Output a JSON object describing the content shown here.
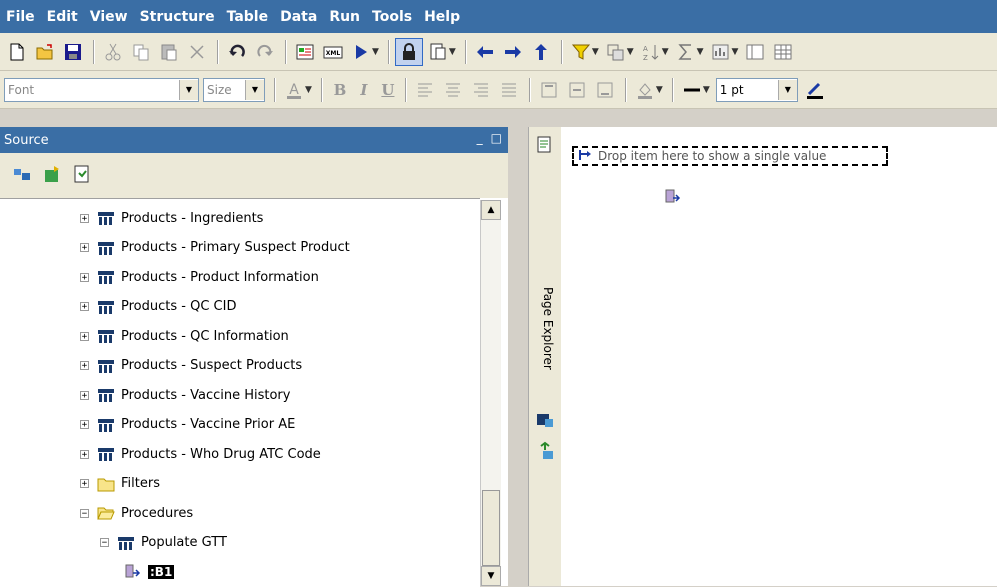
{
  "menu": [
    "File",
    "Edit",
    "View",
    "Structure",
    "Table",
    "Data",
    "Run",
    "Tools",
    "Help"
  ],
  "format_toolbar": {
    "font_placeholder": "Font",
    "size_placeholder": "Size",
    "bold": "B",
    "italic": "I",
    "underline": "U",
    "line_width": "1 pt"
  },
  "source": {
    "title": "Source",
    "minimize": "_",
    "maximize": "□",
    "tree": [
      {
        "label": "Products - Ingredients",
        "type": "query",
        "expander": "+",
        "level": 2
      },
      {
        "label": "Products - Primary Suspect Product",
        "type": "query",
        "expander": "+",
        "level": 2
      },
      {
        "label": "Products - Product Information",
        "type": "query",
        "expander": "+",
        "level": 2
      },
      {
        "label": "Products - QC CID",
        "type": "query",
        "expander": "+",
        "level": 2
      },
      {
        "label": "Products - QC Information",
        "type": "query",
        "expander": "+",
        "level": 2
      },
      {
        "label": "Products - Suspect Products",
        "type": "query",
        "expander": "+",
        "level": 2
      },
      {
        "label": "Products - Vaccine History",
        "type": "query",
        "expander": "+",
        "level": 2
      },
      {
        "label": "Products - Vaccine Prior AE",
        "type": "query",
        "expander": "+",
        "level": 2
      },
      {
        "label": "Products - Who Drug ATC Code",
        "type": "query",
        "expander": "+",
        "level": 2
      },
      {
        "label": "Filters",
        "type": "folder",
        "expander": "+",
        "level": 2
      },
      {
        "label": "Procedures",
        "type": "folder-open",
        "expander": "−",
        "level": 2
      },
      {
        "label": "Populate GTT",
        "type": "query",
        "expander": "−",
        "level": 3
      },
      {
        "label": ":B1",
        "type": "param",
        "expander": "",
        "level": 4
      }
    ]
  },
  "page_explorer": {
    "label": "Page Explorer"
  },
  "canvas": {
    "drop_hint": "Drop item here to show a single value"
  }
}
